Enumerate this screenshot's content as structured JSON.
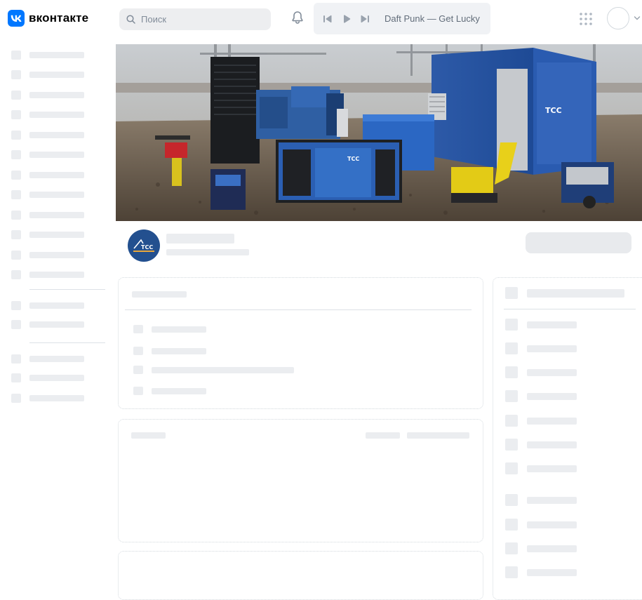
{
  "header": {
    "logo_text": "вконтакте",
    "search_placeholder": "Поиск",
    "player": {
      "track": "Daft Punk — Get Lucky"
    }
  },
  "icons": {
    "logo": "vk-logo-icon",
    "search": "search-icon",
    "notifications": "bell-icon",
    "prev": "skip-previous-icon",
    "play": "play-icon",
    "next": "skip-next-icon",
    "apps": "grid-icon",
    "profile": "avatar-icon",
    "menu_chevron": "chevron-down-icon"
  },
  "group": {
    "logo_text": "TCC"
  },
  "colors": {
    "brand": "#0077ff",
    "skeleton": "#ebedf0",
    "group_logo": "#23508f"
  }
}
